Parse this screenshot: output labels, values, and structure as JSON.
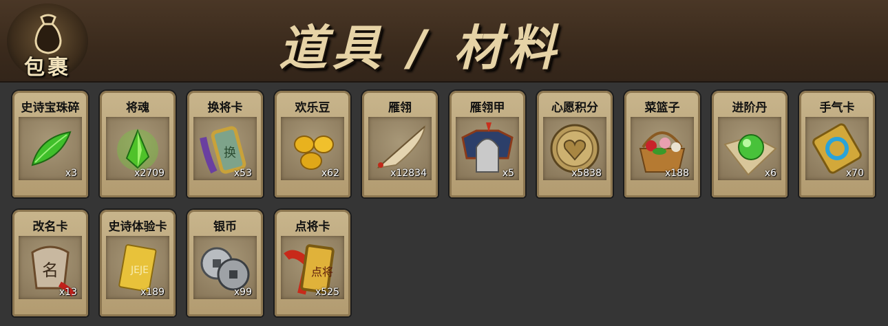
{
  "header": {
    "bag_label": "包裹",
    "title": "道具 / 材料"
  },
  "items": [
    {
      "name": "史诗宝珠碎",
      "count": "x3",
      "icon": "green-leaf-shard-icon"
    },
    {
      "name": "将魂",
      "count": "x2709",
      "icon": "green-crystal-icon"
    },
    {
      "name": "换将卡",
      "count": "x53",
      "icon": "general-swap-token-icon"
    },
    {
      "name": "欢乐豆",
      "count": "x62",
      "icon": "gold-beans-icon"
    },
    {
      "name": "雁翎",
      "count": "x12834",
      "icon": "feather-icon"
    },
    {
      "name": "雁翎甲",
      "count": "x5",
      "icon": "armor-helmet-icon"
    },
    {
      "name": "心愿积分",
      "count": "x5838",
      "icon": "heart-coin-icon"
    },
    {
      "name": "菜篮子",
      "count": "x188",
      "icon": "flower-basket-icon"
    },
    {
      "name": "进阶丹",
      "count": "x6",
      "icon": "green-pill-orb-icon"
    },
    {
      "name": "手气卡",
      "count": "x70",
      "icon": "luck-card-icon"
    },
    {
      "name": "改名卡",
      "count": "x13",
      "icon": "rename-token-icon"
    },
    {
      "name": "史诗体验卡",
      "count": "x189",
      "icon": "gold-card-icon"
    },
    {
      "name": "银币",
      "count": "x99",
      "icon": "silver-coins-icon"
    },
    {
      "name": "点将卡",
      "count": "x525",
      "icon": "general-pick-token-icon"
    }
  ],
  "colors": {
    "background": "#353535",
    "header": "#3a2a1c",
    "slot": "#c8b58c",
    "title_text": "#e6d3a6"
  }
}
